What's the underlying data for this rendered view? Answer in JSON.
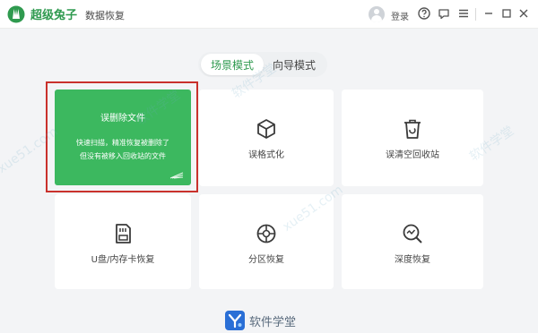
{
  "titlebar": {
    "brand": "超级兔子",
    "subtitle": "数据恢复",
    "login": "登录",
    "icons": [
      "avatar",
      "help-icon",
      "feedback-icon",
      "menu-icon",
      "minimize-icon",
      "close-icon"
    ]
  },
  "mode_toggle": {
    "active": "场景模式",
    "inactive": "向导模式"
  },
  "featured": {
    "title": "误删除文件",
    "desc_line1": "快速扫描，精准恢复被删除了",
    "desc_line2": "但没有被移入回收站的文件"
  },
  "cards": [
    {
      "label": "误格式化",
      "icon": "box-icon"
    },
    {
      "label": "误清空回收站",
      "icon": "trash-icon"
    },
    {
      "label": "U盘/内存卡恢复",
      "icon": "sdcard-icon"
    },
    {
      "label": "分区恢复",
      "icon": "partition-icon"
    },
    {
      "label": "深度恢复",
      "icon": "deep-scan-icon"
    }
  ],
  "footer": {
    "text": "软件学堂"
  },
  "watermarks": [
    "xue51.com",
    "软件学堂",
    "软件学堂",
    "xue51.com",
    "软件学堂"
  ]
}
